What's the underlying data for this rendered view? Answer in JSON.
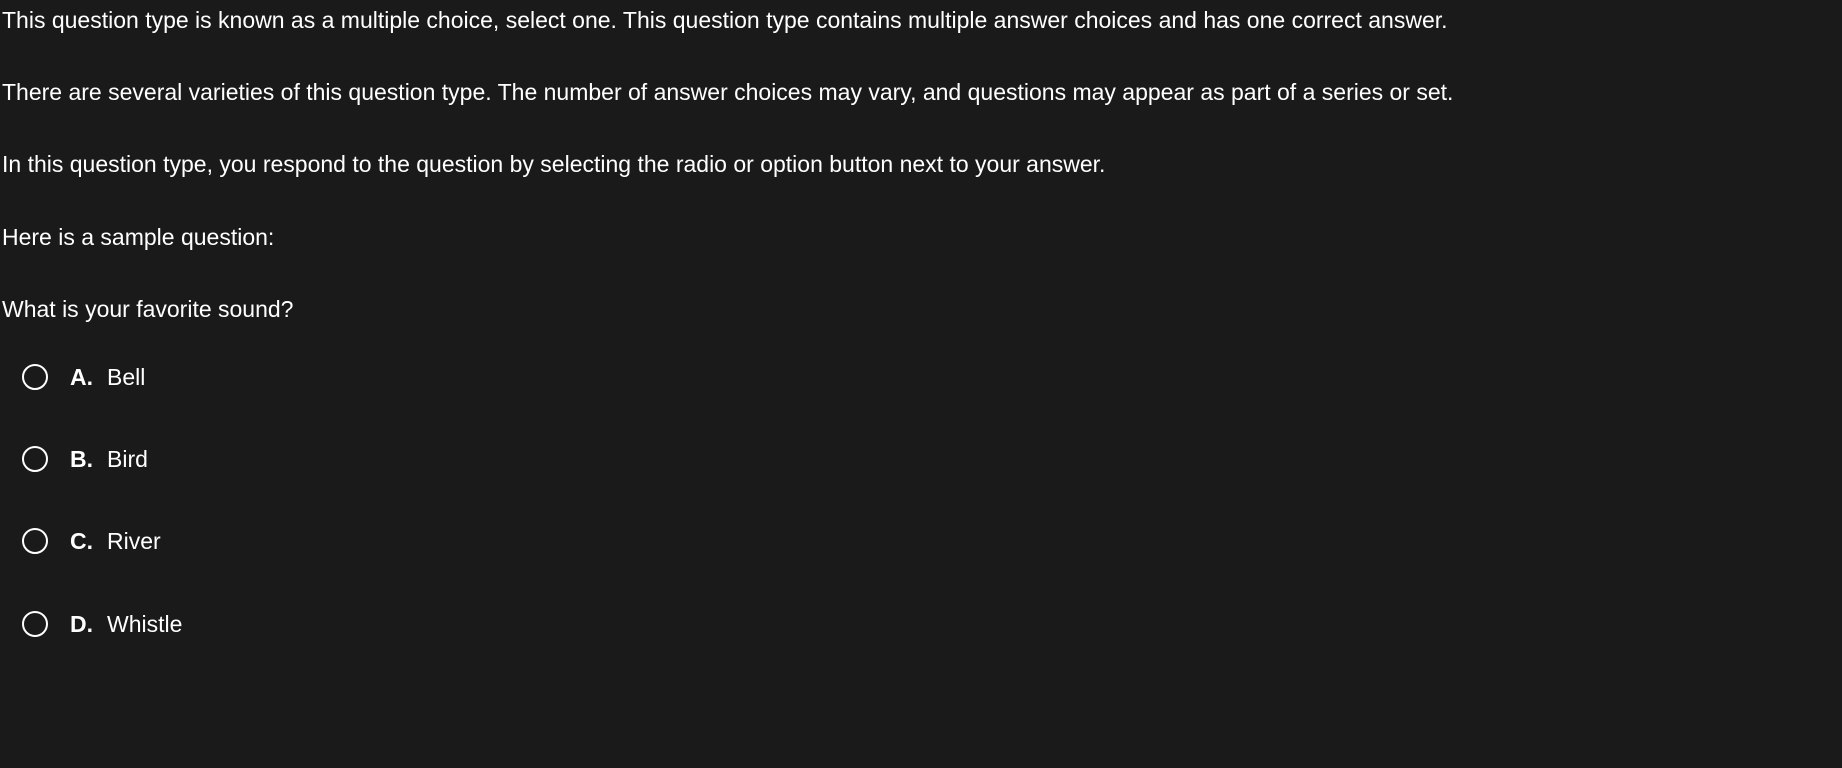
{
  "description": {
    "p1": "This question type is known as a multiple choice, select one. This question type contains multiple answer choices and has one correct answer.",
    "p2": "There are several varieties of this question type. The number of answer choices may vary, and questions may appear as part of a series or set.",
    "p3": "In this question type, you respond to the question by selecting the radio or option button next to your answer."
  },
  "sampleHeading": "Here is a sample question:",
  "question": "What is your favorite sound?",
  "options": [
    {
      "letter": "A.",
      "label": "Bell"
    },
    {
      "letter": "B.",
      "label": "Bird"
    },
    {
      "letter": "C.",
      "label": "River"
    },
    {
      "letter": "D.",
      "label": "Whistle"
    }
  ]
}
